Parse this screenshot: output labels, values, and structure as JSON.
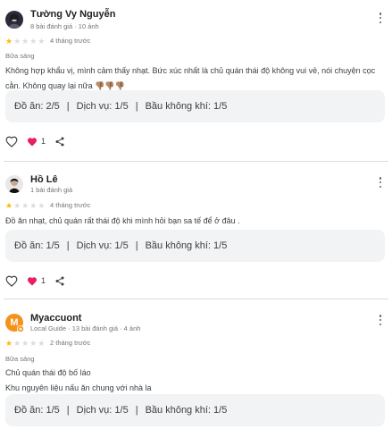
{
  "reviews": [
    {
      "name": "Tường Vy Nguyễn",
      "meta": "8 bài đánh giá · 10 ảnh",
      "rating": 1,
      "when": "4 tháng trước",
      "meal": "Bữa sáng",
      "text": [
        "Không hợp khẩu vị, mình cảm thấy nhạt. Bức xúc nhất là chủ quán thái độ không vui vẻ, nói chuyện cọc cằn. Không quay lại nữa 👎🏽👎🏽👎🏽"
      ],
      "ratings": [
        "Đồ ăn: 2/5",
        "Dịch vụ: 1/5",
        "Bầu không khí: 1/5"
      ],
      "likes": "1"
    },
    {
      "name": "Hồ Lê",
      "meta": "1 bài đánh giá",
      "rating": 1,
      "when": "4 tháng trước",
      "text": [
        "Đồ ăn nhạt, chủ quán rất thái độ khi mình hỏi bạn sa tế để ở đâu ."
      ],
      "ratings": [
        "Đồ ăn: 1/5",
        "Dịch vụ: 1/5",
        "Bầu không khí: 1/5"
      ],
      "likes": "1"
    },
    {
      "name": "Myaccuont",
      "avatar_letter": "M",
      "meta": "Local Guide · 13 bài đánh giá · 4 ảnh",
      "rating": 1,
      "when": "2 tháng trước",
      "meal": "Bữa sáng",
      "text": [
        "Chủ quán thái độ bố láo",
        "Khu nguyên liệu nấu ăn chung với nhà la"
      ],
      "ratings": [
        "Đồ ăn: 1/5",
        "Dịch vụ: 1/5",
        "Bầu không khí: 1/5"
      ]
    }
  ],
  "colors": {
    "star_on": "#fbbc04",
    "star_off": "#dadce0",
    "like_heart": "#e91e63",
    "avatar_local_guide": "#f5921b"
  },
  "icons": [
    "more-vert-icon",
    "star-icon",
    "heart-outline-icon",
    "heart-filled-icon",
    "share-icon",
    "local-guide-badge-icon"
  ]
}
